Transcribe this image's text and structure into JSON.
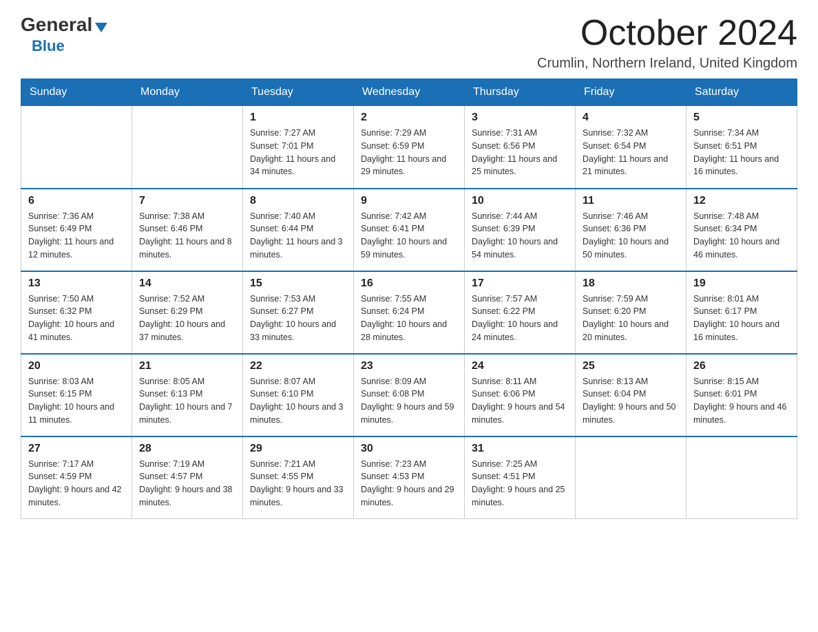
{
  "logo": {
    "general": "General",
    "blue": "Blue",
    "triangle": "▼"
  },
  "header": {
    "month_year": "October 2024",
    "location": "Crumlin, Northern Ireland, United Kingdom"
  },
  "weekdays": [
    "Sunday",
    "Monday",
    "Tuesday",
    "Wednesday",
    "Thursday",
    "Friday",
    "Saturday"
  ],
  "weeks": [
    [
      {
        "day": "",
        "sunrise": "",
        "sunset": "",
        "daylight": ""
      },
      {
        "day": "",
        "sunrise": "",
        "sunset": "",
        "daylight": ""
      },
      {
        "day": "1",
        "sunrise": "Sunrise: 7:27 AM",
        "sunset": "Sunset: 7:01 PM",
        "daylight": "Daylight: 11 hours and 34 minutes."
      },
      {
        "day": "2",
        "sunrise": "Sunrise: 7:29 AM",
        "sunset": "Sunset: 6:59 PM",
        "daylight": "Daylight: 11 hours and 29 minutes."
      },
      {
        "day": "3",
        "sunrise": "Sunrise: 7:31 AM",
        "sunset": "Sunset: 6:56 PM",
        "daylight": "Daylight: 11 hours and 25 minutes."
      },
      {
        "day": "4",
        "sunrise": "Sunrise: 7:32 AM",
        "sunset": "Sunset: 6:54 PM",
        "daylight": "Daylight: 11 hours and 21 minutes."
      },
      {
        "day": "5",
        "sunrise": "Sunrise: 7:34 AM",
        "sunset": "Sunset: 6:51 PM",
        "daylight": "Daylight: 11 hours and 16 minutes."
      }
    ],
    [
      {
        "day": "6",
        "sunrise": "Sunrise: 7:36 AM",
        "sunset": "Sunset: 6:49 PM",
        "daylight": "Daylight: 11 hours and 12 minutes."
      },
      {
        "day": "7",
        "sunrise": "Sunrise: 7:38 AM",
        "sunset": "Sunset: 6:46 PM",
        "daylight": "Daylight: 11 hours and 8 minutes."
      },
      {
        "day": "8",
        "sunrise": "Sunrise: 7:40 AM",
        "sunset": "Sunset: 6:44 PM",
        "daylight": "Daylight: 11 hours and 3 minutes."
      },
      {
        "day": "9",
        "sunrise": "Sunrise: 7:42 AM",
        "sunset": "Sunset: 6:41 PM",
        "daylight": "Daylight: 10 hours and 59 minutes."
      },
      {
        "day": "10",
        "sunrise": "Sunrise: 7:44 AM",
        "sunset": "Sunset: 6:39 PM",
        "daylight": "Daylight: 10 hours and 54 minutes."
      },
      {
        "day": "11",
        "sunrise": "Sunrise: 7:46 AM",
        "sunset": "Sunset: 6:36 PM",
        "daylight": "Daylight: 10 hours and 50 minutes."
      },
      {
        "day": "12",
        "sunrise": "Sunrise: 7:48 AM",
        "sunset": "Sunset: 6:34 PM",
        "daylight": "Daylight: 10 hours and 46 minutes."
      }
    ],
    [
      {
        "day": "13",
        "sunrise": "Sunrise: 7:50 AM",
        "sunset": "Sunset: 6:32 PM",
        "daylight": "Daylight: 10 hours and 41 minutes."
      },
      {
        "day": "14",
        "sunrise": "Sunrise: 7:52 AM",
        "sunset": "Sunset: 6:29 PM",
        "daylight": "Daylight: 10 hours and 37 minutes."
      },
      {
        "day": "15",
        "sunrise": "Sunrise: 7:53 AM",
        "sunset": "Sunset: 6:27 PM",
        "daylight": "Daylight: 10 hours and 33 minutes."
      },
      {
        "day": "16",
        "sunrise": "Sunrise: 7:55 AM",
        "sunset": "Sunset: 6:24 PM",
        "daylight": "Daylight: 10 hours and 28 minutes."
      },
      {
        "day": "17",
        "sunrise": "Sunrise: 7:57 AM",
        "sunset": "Sunset: 6:22 PM",
        "daylight": "Daylight: 10 hours and 24 minutes."
      },
      {
        "day": "18",
        "sunrise": "Sunrise: 7:59 AM",
        "sunset": "Sunset: 6:20 PM",
        "daylight": "Daylight: 10 hours and 20 minutes."
      },
      {
        "day": "19",
        "sunrise": "Sunrise: 8:01 AM",
        "sunset": "Sunset: 6:17 PM",
        "daylight": "Daylight: 10 hours and 16 minutes."
      }
    ],
    [
      {
        "day": "20",
        "sunrise": "Sunrise: 8:03 AM",
        "sunset": "Sunset: 6:15 PM",
        "daylight": "Daylight: 10 hours and 11 minutes."
      },
      {
        "day": "21",
        "sunrise": "Sunrise: 8:05 AM",
        "sunset": "Sunset: 6:13 PM",
        "daylight": "Daylight: 10 hours and 7 minutes."
      },
      {
        "day": "22",
        "sunrise": "Sunrise: 8:07 AM",
        "sunset": "Sunset: 6:10 PM",
        "daylight": "Daylight: 10 hours and 3 minutes."
      },
      {
        "day": "23",
        "sunrise": "Sunrise: 8:09 AM",
        "sunset": "Sunset: 6:08 PM",
        "daylight": "Daylight: 9 hours and 59 minutes."
      },
      {
        "day": "24",
        "sunrise": "Sunrise: 8:11 AM",
        "sunset": "Sunset: 6:06 PM",
        "daylight": "Daylight: 9 hours and 54 minutes."
      },
      {
        "day": "25",
        "sunrise": "Sunrise: 8:13 AM",
        "sunset": "Sunset: 6:04 PM",
        "daylight": "Daylight: 9 hours and 50 minutes."
      },
      {
        "day": "26",
        "sunrise": "Sunrise: 8:15 AM",
        "sunset": "Sunset: 6:01 PM",
        "daylight": "Daylight: 9 hours and 46 minutes."
      }
    ],
    [
      {
        "day": "27",
        "sunrise": "Sunrise: 7:17 AM",
        "sunset": "Sunset: 4:59 PM",
        "daylight": "Daylight: 9 hours and 42 minutes."
      },
      {
        "day": "28",
        "sunrise": "Sunrise: 7:19 AM",
        "sunset": "Sunset: 4:57 PM",
        "daylight": "Daylight: 9 hours and 38 minutes."
      },
      {
        "day": "29",
        "sunrise": "Sunrise: 7:21 AM",
        "sunset": "Sunset: 4:55 PM",
        "daylight": "Daylight: 9 hours and 33 minutes."
      },
      {
        "day": "30",
        "sunrise": "Sunrise: 7:23 AM",
        "sunset": "Sunset: 4:53 PM",
        "daylight": "Daylight: 9 hours and 29 minutes."
      },
      {
        "day": "31",
        "sunrise": "Sunrise: 7:25 AM",
        "sunset": "Sunset: 4:51 PM",
        "daylight": "Daylight: 9 hours and 25 minutes."
      },
      {
        "day": "",
        "sunrise": "",
        "sunset": "",
        "daylight": ""
      },
      {
        "day": "",
        "sunrise": "",
        "sunset": "",
        "daylight": ""
      }
    ]
  ]
}
